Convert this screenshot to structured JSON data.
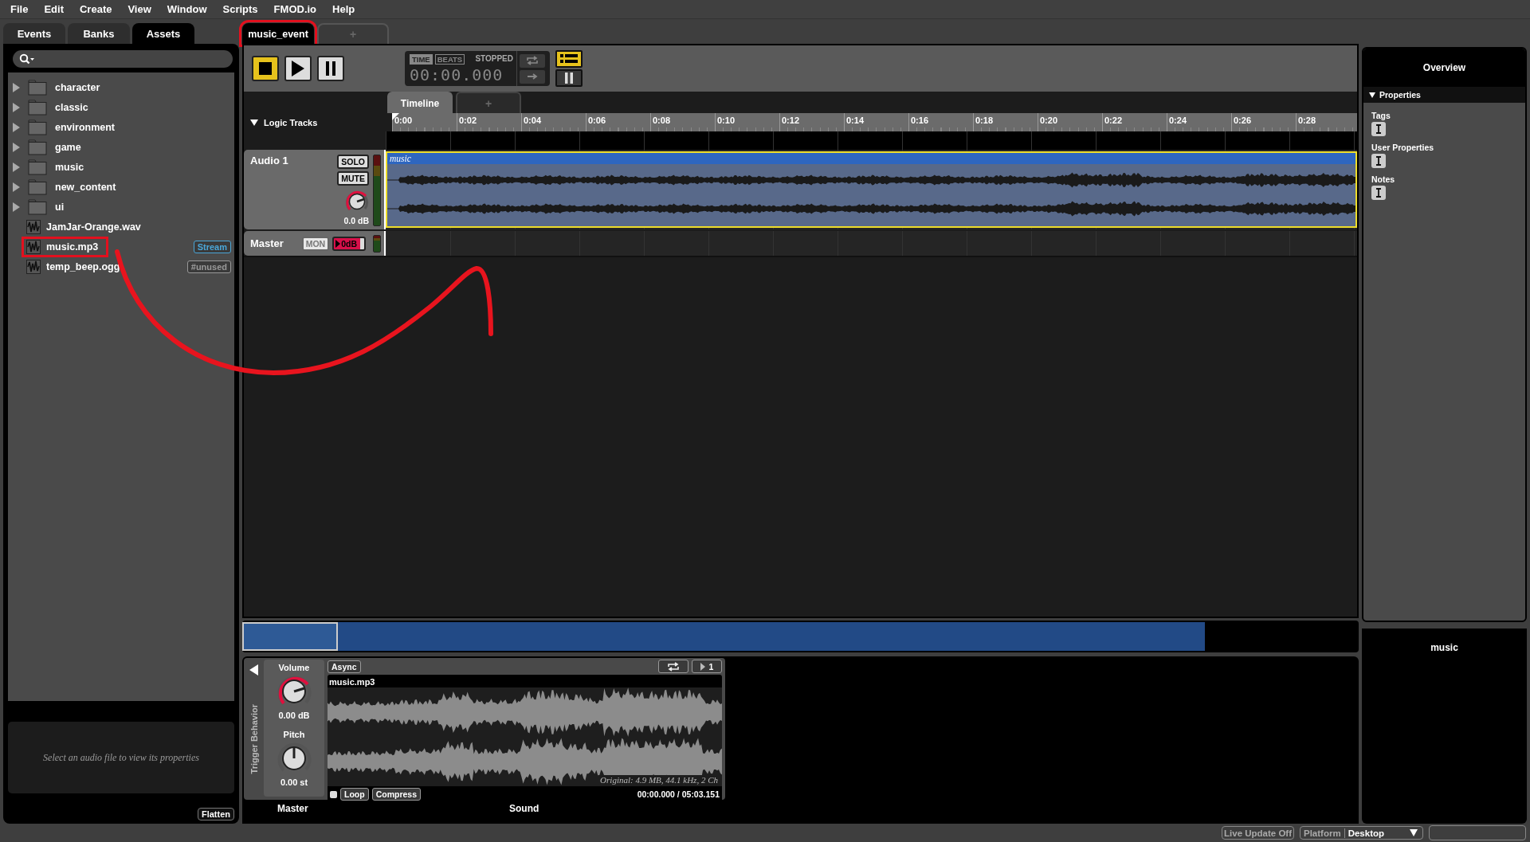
{
  "menu": [
    "File",
    "Edit",
    "Create",
    "View",
    "Window",
    "Scripts",
    "FMOD.io",
    "Help"
  ],
  "browser_tabs": [
    {
      "label": "Events",
      "selected": false
    },
    {
      "label": "Banks",
      "selected": false
    },
    {
      "label": "Assets",
      "selected": true
    }
  ],
  "assets": [
    {
      "kind": "folder",
      "name": "character",
      "expanded": false
    },
    {
      "kind": "folder",
      "name": "classic",
      "expanded": false
    },
    {
      "kind": "folder",
      "name": "environment",
      "expanded": false
    },
    {
      "kind": "folder",
      "name": "game",
      "expanded": false
    },
    {
      "kind": "folder",
      "name": "music",
      "expanded": false
    },
    {
      "kind": "folder",
      "name": "new_content",
      "expanded": false
    },
    {
      "kind": "folder",
      "name": "ui",
      "expanded": false
    },
    {
      "kind": "file",
      "name": "JamJar-Orange.wav",
      "highlighted": false
    },
    {
      "kind": "file",
      "name": "music.mp3",
      "highlighted": true,
      "badge": {
        "text": "Stream",
        "color": "#4aa6d8"
      }
    },
    {
      "kind": "file",
      "name": "temp_beep.ogg",
      "highlighted": false,
      "badge": {
        "text": "#unused",
        "color": "#999999"
      }
    }
  ],
  "properties_hint": "Select an audio file to view its properties",
  "flatten_button": "Flatten",
  "event_tabs": [
    {
      "label": "music_event",
      "selected": true,
      "highlighted": true
    },
    {
      "label": "+",
      "selected": false,
      "highlighted": false
    }
  ],
  "transport": {
    "buttons": [
      {
        "kind": "stop",
        "active": true
      },
      {
        "kind": "play",
        "active": false
      },
      {
        "kind": "pause",
        "active": false
      }
    ],
    "modes": [
      {
        "label": "TIME",
        "selected": true
      },
      {
        "label": "BEATS",
        "selected": false
      }
    ],
    "status": "STOPPED",
    "time": "00:00.000",
    "toggles": [
      {
        "kind": "list",
        "on": true
      },
      {
        "kind": "pause",
        "on": false
      }
    ]
  },
  "timeline_tabs": [
    {
      "label": "Timeline",
      "selected": true
    },
    {
      "label": "+",
      "selected": false
    }
  ],
  "logic_tracks": {
    "label": "Logic Tracks",
    "expanded": true
  },
  "ruler": [
    "0:00",
    "0:02",
    "0:04",
    "0:06",
    "0:08",
    "0:10",
    "0:12",
    "0:14",
    "0:16",
    "0:18",
    "0:20",
    "0:22",
    "0:24",
    "0:26",
    "0:28"
  ],
  "audio_track": {
    "name": "Audio 1",
    "solo": "SOLO",
    "mute": "MUTE",
    "volume": "0.0 dB",
    "region": {
      "name": "music",
      "selected": true
    }
  },
  "master_track": {
    "name": "Master",
    "monitor": {
      "label": "MON",
      "disabled": true
    },
    "volume": "0dB"
  },
  "deck": {
    "trigger_label": "Trigger Behavior",
    "volume_label": "Volume",
    "volume": "0.00 dB",
    "pitch_label": "Pitch",
    "pitch": "0.00 st",
    "async": "Async",
    "loop_count": "1",
    "file": "music.mp3",
    "info": "Original: 4.9 MB, 44.1 kHz, 2 Ch",
    "loop": "Loop",
    "compress": "Compress",
    "position": "00:00.000 / 05:03.151",
    "labels": [
      "Master",
      "Sound"
    ]
  },
  "inspector": {
    "title": "Overview",
    "section": "Properties",
    "fields": [
      "Tags",
      "User Properties",
      "Notes"
    ]
  },
  "selection_panel": {
    "title": "music"
  },
  "status_bar": {
    "live_update": "Live Update Off",
    "platform_label": "Platform",
    "platform": "Desktop"
  }
}
